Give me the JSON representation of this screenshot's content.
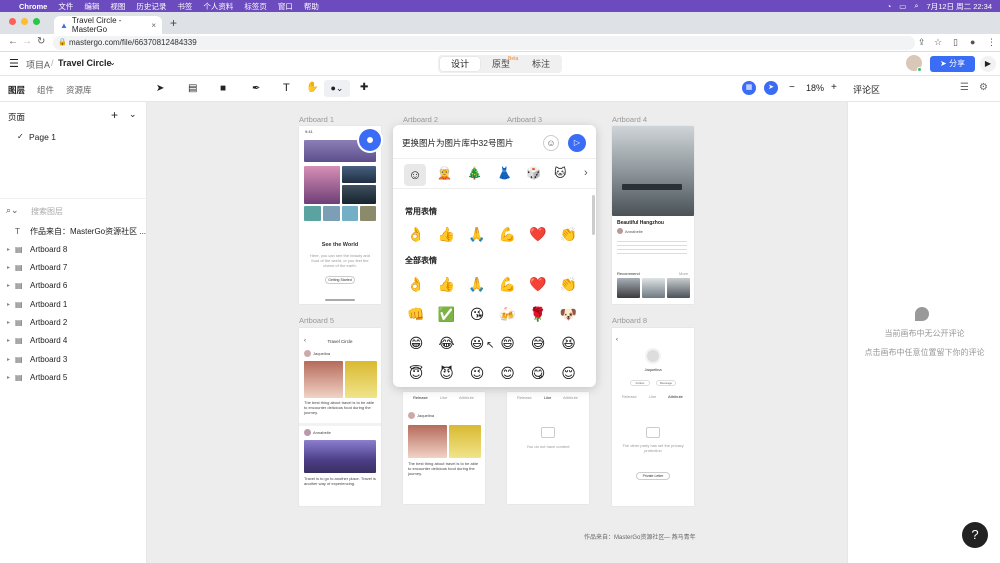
{
  "macbar": {
    "app": "Chrome",
    "menus": [
      "文件",
      "编辑",
      "视图",
      "历史记录",
      "书签",
      "个人资料",
      "标签页",
      "窗口",
      "帮助"
    ],
    "clock": "7月12日 周二  22:34"
  },
  "browser": {
    "tab_title": "Travel Circle - MasterGo",
    "url": "mastergo.com/file/66370812484339"
  },
  "header": {
    "project": "项目A",
    "file_name": "Travel Circle",
    "modes": [
      "设计",
      "原型",
      "标注"
    ],
    "beta_badge": "Beta",
    "share_label": "分享"
  },
  "toolbar": {
    "zoom": "18%"
  },
  "left_panel": {
    "tabs": [
      "图层",
      "组件",
      "资源库"
    ],
    "pages_title": "页面",
    "page_item": "Page 1",
    "search_placeholder": "搜索图层",
    "layers": [
      "作品来自：MasterGo资源社区 ...",
      "Artboard 8",
      "Artboard 7",
      "Artboard 6",
      "Artboard 1",
      "Artboard 2",
      "Artboard 4",
      "Artboard 3",
      "Artboard 5"
    ]
  },
  "right_panel": {
    "title": "评论区",
    "empty_line1": "当前画布中无公开评论",
    "empty_line2": "点击画布中任意位置留下你的评论"
  },
  "canvas": {
    "artboard_labels": [
      "Artboard 1",
      "Artboard 2",
      "Artboard 3",
      "Artboard 4",
      "Artboard 5",
      "Artboard 8"
    ],
    "footer_credit": "作品来自：MasterGo资源社区",
    "footer_author": "— 燕马青年",
    "ab1": {
      "time": "9:41",
      "title": "See the World",
      "desc": "Here, you can see the beauty and food of the world, or you feel the charm of the earth.",
      "button": "Getting Started"
    },
    "ab4": {
      "title": "Beautiful Hangzhou",
      "author": "Annabelle",
      "recommend": "Recommend",
      "more": "More"
    },
    "ab5": {
      "title": "Travel Circle",
      "user": "Jaquelina",
      "caption": "The best thing about travel is to be able to encounter delicious food during the journey.",
      "user2": "Annabelle",
      "caption2": "Travel is to go to another place. Travel is another way of experiencing."
    },
    "ab2": {
      "tabs": [
        "Release",
        "Like",
        "Attribute"
      ],
      "user": "Jaquelina",
      "caption": "The best thing about travel is to be able to encounter delicious food during the journey."
    },
    "ab3": {
      "tabs": [
        "Release",
        "Like",
        "Attribute"
      ],
      "empty": "You do not have content"
    },
    "ab8": {
      "user": "Jaquelina",
      "tabs": [
        "Release",
        "Like",
        "Attribute"
      ],
      "empty": "The other party has set the privacy protection",
      "button": "Private Letter",
      "follow": "Follow",
      "message": "Message"
    }
  },
  "comment": {
    "text": "更换图片为图片库中32号图片"
  },
  "emoji_picker": {
    "category_icons": [
      "☺",
      "🧝",
      "🎄",
      "👗",
      "🎲",
      "🐱",
      "›"
    ],
    "section_common": "常用表情",
    "common": [
      "👌",
      "👍",
      "🙏",
      "💪",
      "❤️",
      "👏"
    ],
    "section_all": "全部表情",
    "all": [
      "👌",
      "👍",
      "🙏",
      "💪",
      "❤️",
      "👏",
      "👊",
      "✅",
      "😘",
      "🍻",
      "🌹",
      "🐶",
      "😁",
      "😂",
      "😃",
      "😄",
      "😅",
      "😆",
      "😇",
      "😈",
      "😉",
      "😊",
      "😋",
      "😌"
    ]
  },
  "help_button": "?"
}
